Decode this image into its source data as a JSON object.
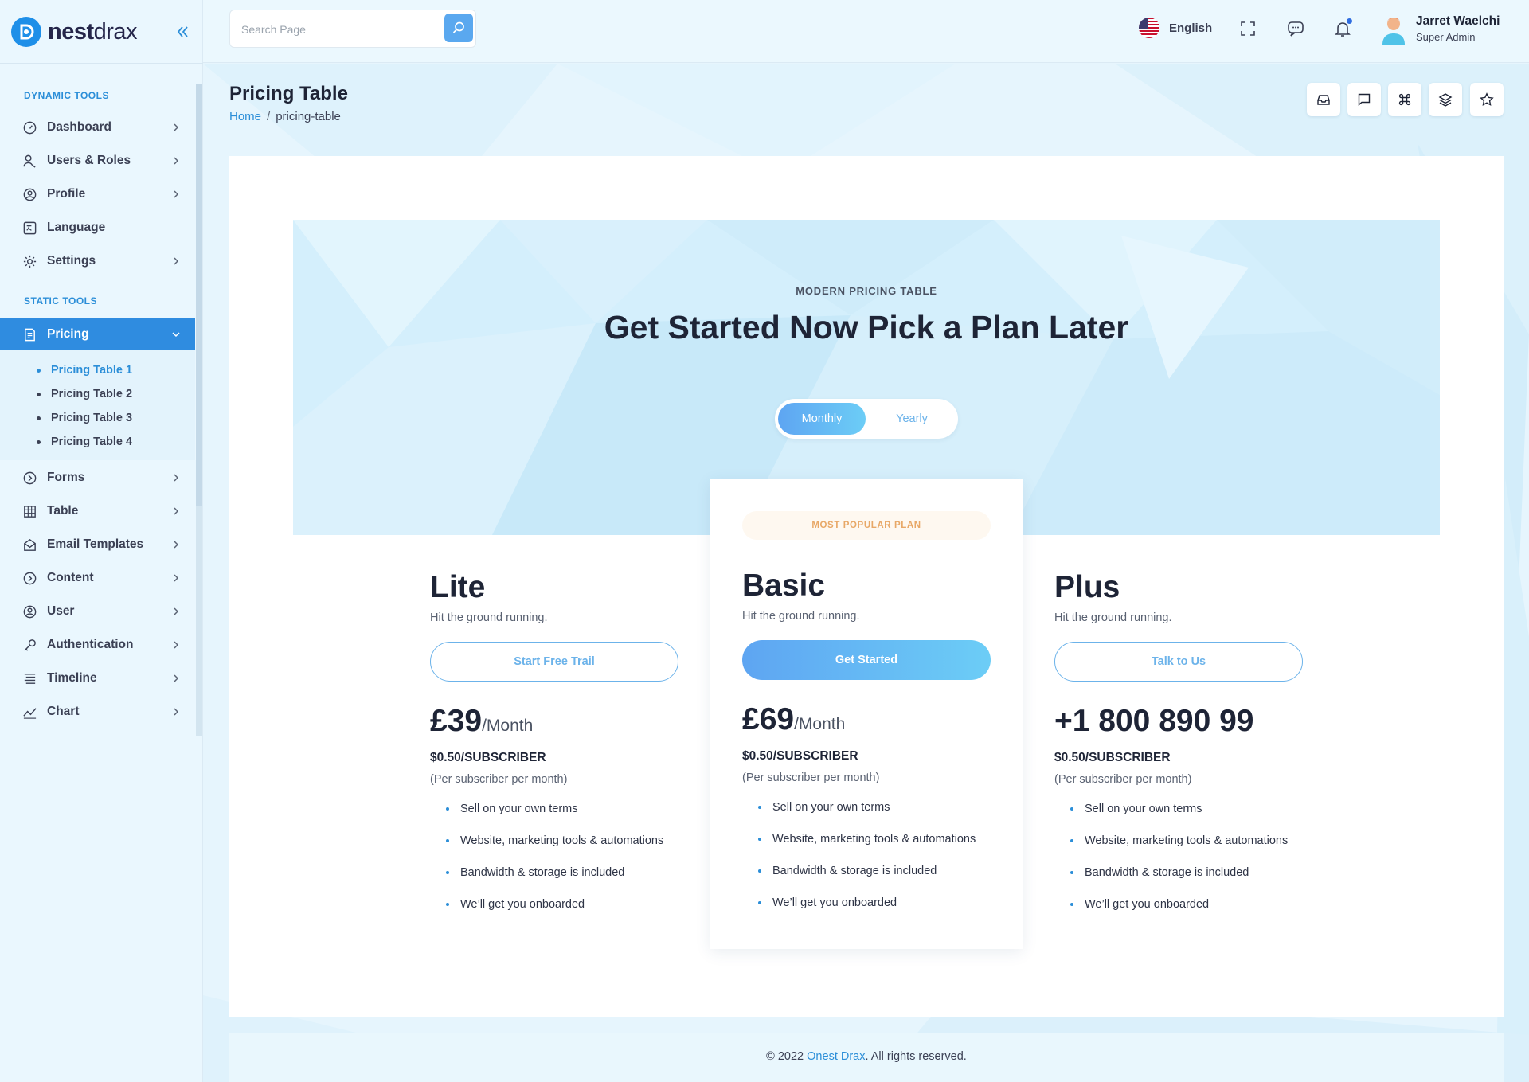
{
  "brand": {
    "name_bold": "nest",
    "name_light": "drax"
  },
  "sidebar": {
    "sections": [
      "DYNAMIC TOOLS",
      "STATIC TOOLS"
    ],
    "items": [
      {
        "label": "Dashboard",
        "icon": "gauge-icon"
      },
      {
        "label": "Users & Roles",
        "icon": "users-icon"
      },
      {
        "label": "Profile",
        "icon": "user-circle-icon"
      },
      {
        "label": "Language",
        "icon": "translate-icon"
      },
      {
        "label": "Settings",
        "icon": "gear-icon"
      },
      {
        "label": "Pricing",
        "icon": "receipt-icon"
      },
      {
        "label": "Forms",
        "icon": "arrow-circle-icon"
      },
      {
        "label": "Table",
        "icon": "grid-icon"
      },
      {
        "label": "Email Templates",
        "icon": "mail-icon"
      },
      {
        "label": "Content",
        "icon": "arrow-circle-icon"
      },
      {
        "label": "User",
        "icon": "user-circle-icon"
      },
      {
        "label": "Authentication",
        "icon": "key-icon"
      },
      {
        "label": "Timeline",
        "icon": "timeline-icon"
      },
      {
        "label": "Chart",
        "icon": "chart-icon"
      }
    ],
    "pricing_sub": [
      "Pricing Table 1",
      "Pricing Table 2",
      "Pricing Table 3",
      "Pricing Table 4"
    ]
  },
  "header": {
    "search_placeholder": "Search Page",
    "language": "English",
    "user_name": "Jarret Waelchi",
    "user_role": "Super Admin"
  },
  "page": {
    "title": "Pricing Table",
    "breadcrumb_home": "Home",
    "breadcrumb_sep": "/",
    "breadcrumb_current": "pricing-table"
  },
  "hero": {
    "eyebrow": "MODERN PRICING TABLE",
    "title": "Get Started Now Pick a Plan Later",
    "toggle_on": "Monthly",
    "toggle_off": "Yearly"
  },
  "plans": [
    {
      "name": "Lite",
      "tagline": "Hit the ground running.",
      "button": "Start Free Trail",
      "price": "£39",
      "period": "/Month",
      "sub": "$0.50/SUBSCRIBER",
      "note": "(Per subscriber per month)",
      "features": [
        "Sell on your own terms",
        "Website, marketing tools & automations",
        "Bandwidth & storage is included",
        "We’ll get you onboarded"
      ]
    },
    {
      "badge": "MOST POPULAR PLAN",
      "name": "Basic",
      "tagline": "Hit the ground running.",
      "button": "Get Started",
      "price": "£69",
      "period": "/Month",
      "sub": "$0.50/SUBSCRIBER",
      "note": "(Per subscriber per month)",
      "features": [
        "Sell on your own terms",
        "Website, marketing tools & automations",
        "Bandwidth & storage is included",
        "We’ll get you onboarded"
      ]
    },
    {
      "name": "Plus",
      "tagline": "Hit the ground running.",
      "button": "Talk to Us",
      "price": "+1 800 890 99",
      "sub": "$0.50/SUBSCRIBER",
      "note": "(Per subscriber per month)",
      "features": [
        "Sell on your own terms",
        "Website, marketing tools & automations",
        "Bandwidth & storage is included",
        "We’ll get you onboarded"
      ]
    }
  ],
  "footer": {
    "prefix": "© 2022 ",
    "link": "Onest Drax",
    "suffix": ". All rights reserved."
  },
  "colors": {
    "accent": "#2b8ed8",
    "accent_btn": "#5ea5f2",
    "badge_text": "#e8a867"
  }
}
